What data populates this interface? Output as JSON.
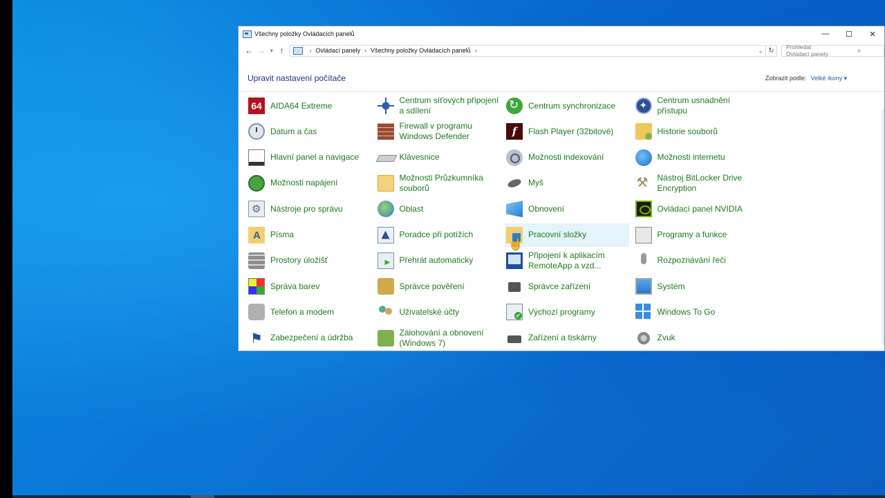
{
  "window": {
    "title": "Všechny položky Ovládacích panelů",
    "controls": {
      "minimize": "—",
      "maximize": "☐",
      "close": "✕"
    }
  },
  "addressbar": {
    "breadcrumbs": [
      "Ovládací panely",
      "Všechny položky Ovládacích panelů"
    ],
    "search_placeholder": "Prohledat Ovládací panely"
  },
  "header": {
    "title": "Upravit nastavení počítače",
    "view_by_label": "Zobrazit podle:",
    "view_by_value": "Velké ikony"
  },
  "items": [
    {
      "label": "AIDA64 Extreme",
      "icon": "aida64-icon"
    },
    {
      "label": "Centrum síťových připojení a sdílení",
      "icon": "network-center-icon"
    },
    {
      "label": "Centrum synchronizace",
      "icon": "sync-center-icon"
    },
    {
      "label": "Centrum usnadnění přístupu",
      "icon": "ease-of-access-icon"
    },
    {
      "label": "Datum a čas",
      "icon": "clock-icon"
    },
    {
      "label": "Firewall v programu Windows Defender",
      "icon": "firewall-icon"
    },
    {
      "label": "Flash Player (32bitové)",
      "icon": "flash-icon"
    },
    {
      "label": "Historie souborů",
      "icon": "file-history-icon"
    },
    {
      "label": "Hlavní panel a navigace",
      "icon": "taskbar-icon"
    },
    {
      "label": "Klávesnice",
      "icon": "keyboard-icon"
    },
    {
      "label": "Možnosti indexování",
      "icon": "indexing-icon"
    },
    {
      "label": "Možnosti internetu",
      "icon": "internet-options-icon"
    },
    {
      "label": "Možnosti napájení",
      "icon": "power-icon"
    },
    {
      "label": "Možnosti Průzkumníka souborů",
      "icon": "folder-options-icon"
    },
    {
      "label": "Myš",
      "icon": "mouse-icon"
    },
    {
      "label": "Nástroj BitLocker Drive Encryption",
      "icon": "bitlocker-icon"
    },
    {
      "label": "Nástroje pro správu",
      "icon": "admin-tools-icon"
    },
    {
      "label": "Oblast",
      "icon": "region-icon"
    },
    {
      "label": "Obnovení",
      "icon": "recovery-icon"
    },
    {
      "label": "Ovládací panel NVIDIA",
      "icon": "nvidia-icon"
    },
    {
      "label": "Písma",
      "icon": "fonts-icon"
    },
    {
      "label": "Poradce při potížích",
      "icon": "troubleshooting-icon"
    },
    {
      "label": "Pracovní složky",
      "icon": "work-folders-icon"
    },
    {
      "label": "Programy a funkce",
      "icon": "programs-icon"
    },
    {
      "label": "Prostory úložišť",
      "icon": "storage-spaces-icon"
    },
    {
      "label": "Přehrát automaticky",
      "icon": "autoplay-icon"
    },
    {
      "label": "Připojení k aplikacím RemoteApp a vzd...",
      "icon": "remoteapp-icon"
    },
    {
      "label": "Rozpoznávání řeči",
      "icon": "speech-icon"
    },
    {
      "label": "Správa barev",
      "icon": "color-management-icon"
    },
    {
      "label": "Správce pověření",
      "icon": "credential-manager-icon"
    },
    {
      "label": "Správce zařízení",
      "icon": "device-manager-icon"
    },
    {
      "label": "Systém",
      "icon": "system-icon"
    },
    {
      "label": "Telefon a modem",
      "icon": "phone-modem-icon"
    },
    {
      "label": "Uživatelské účty",
      "icon": "user-accounts-icon"
    },
    {
      "label": "Výchozí programy",
      "icon": "default-programs-icon"
    },
    {
      "label": "Windows To Go",
      "icon": "windows-to-go-icon"
    },
    {
      "label": "Zabezpečení a údržba",
      "icon": "security-flag-icon"
    },
    {
      "label": "Zálohování a obnovení (Windows 7)",
      "icon": "backup-icon"
    },
    {
      "label": "Zařízení a tiskárny",
      "icon": "printers-icon"
    },
    {
      "label": "Zvuk",
      "icon": "sound-icon"
    }
  ],
  "colors": {
    "link_green": "#1e7a1e",
    "title_blue": "#1e3287",
    "desktop_blue": "#0a7bd9",
    "hover_bg": "#e5f3fb"
  }
}
